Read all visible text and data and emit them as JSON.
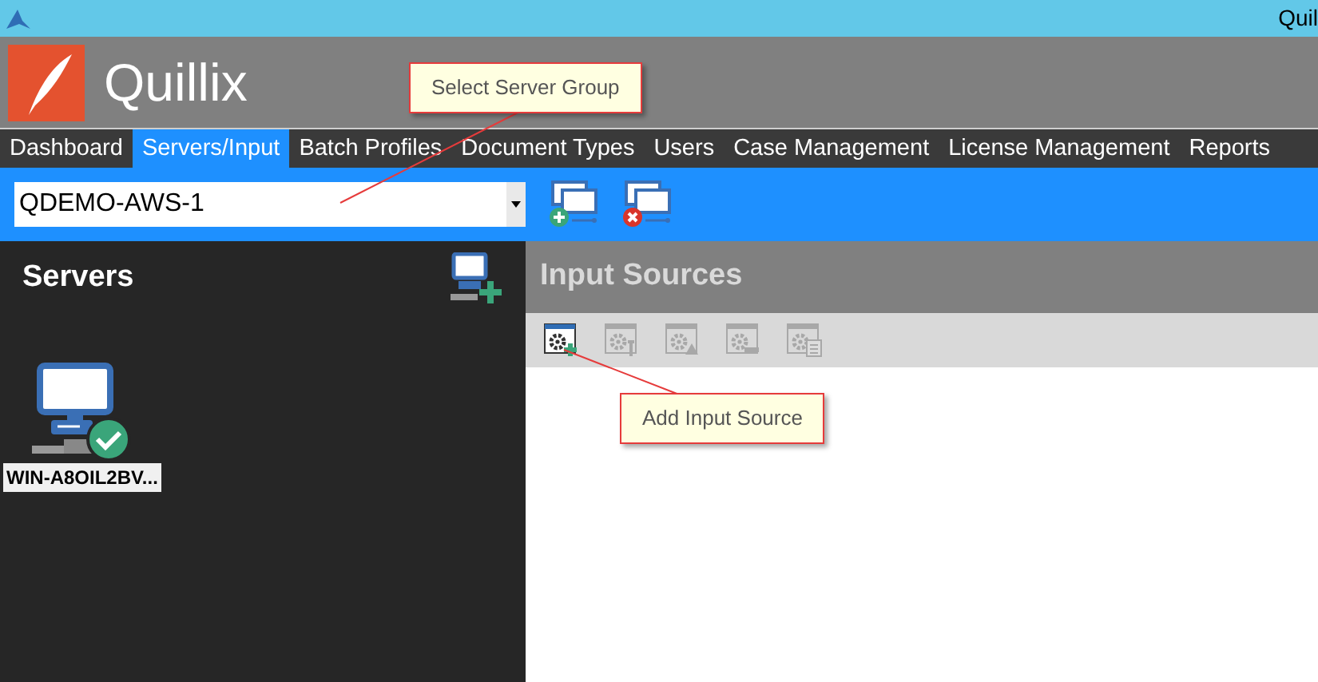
{
  "title_bar": {
    "title": "Quil"
  },
  "app": {
    "name": "Quillix"
  },
  "tabs": [
    {
      "label": "Dashboard",
      "selected": false
    },
    {
      "label": "Servers/Input",
      "selected": true
    },
    {
      "label": "Batch Profiles",
      "selected": false
    },
    {
      "label": "Document Types",
      "selected": false
    },
    {
      "label": "Users",
      "selected": false
    },
    {
      "label": "Case Management",
      "selected": false
    },
    {
      "label": "License Management",
      "selected": false
    },
    {
      "label": "Reports",
      "selected": false
    }
  ],
  "server_group": {
    "value": "QDEMO-AWS-1"
  },
  "group_actions": [
    {
      "kind": "add"
    },
    {
      "kind": "remove"
    }
  ],
  "servers_panel": {
    "title": "Servers",
    "servers": [
      {
        "name": "WIN-A8OIL2BV...",
        "online": true
      }
    ]
  },
  "input_sources": {
    "title": "Input Sources",
    "tools": [
      {
        "kind": "add",
        "disabled": false
      },
      {
        "kind": "edit",
        "disabled": true
      },
      {
        "kind": "warning",
        "disabled": true
      },
      {
        "kind": "remove",
        "disabled": true
      },
      {
        "kind": "list",
        "disabled": true
      }
    ]
  },
  "callouts": [
    {
      "text": "Select Server Group"
    },
    {
      "text": "Add Input Source"
    }
  ]
}
